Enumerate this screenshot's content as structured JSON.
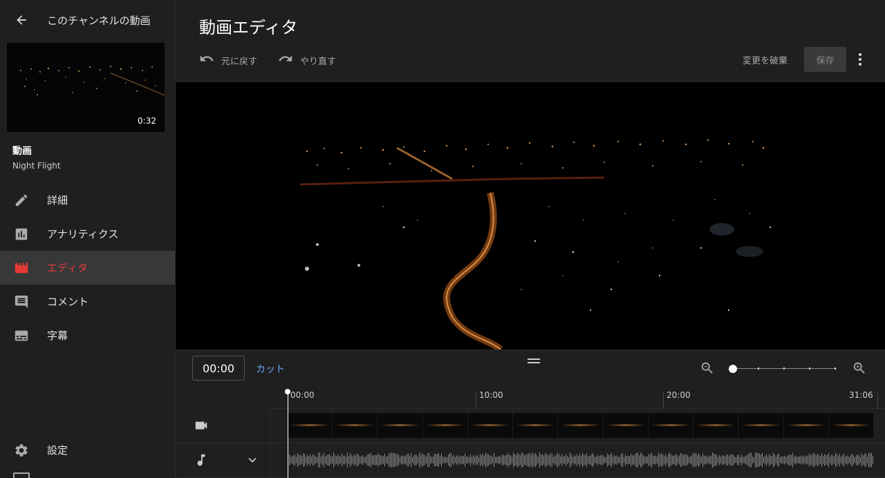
{
  "sidebar": {
    "back_title": "このチャンネルの動画",
    "thumbnail_duration": "0:32",
    "video_label": "動画",
    "video_name": "Night Flight",
    "items": [
      {
        "label": "詳細",
        "icon": "pencil-icon",
        "active": false
      },
      {
        "label": "アナリティクス",
        "icon": "analytics-icon",
        "active": false
      },
      {
        "label": "エディタ",
        "icon": "clapperboard-icon",
        "active": true
      },
      {
        "label": "コメント",
        "icon": "comment-icon",
        "active": false
      },
      {
        "label": "字幕",
        "icon": "subtitles-icon",
        "active": false
      }
    ],
    "settings_label": "設定"
  },
  "header": {
    "title": "動画エディタ",
    "undo_label": "元に戻す",
    "redo_label": "やり直す",
    "discard_label": "変更を破棄",
    "save_label": "保存"
  },
  "controls": {
    "current_time": "00:00",
    "cut_label": "カット",
    "zoom_level": 0
  },
  "timeline": {
    "ruler_labels": [
      "00:00",
      "10:00",
      "20:00",
      "31:06"
    ],
    "playhead_time": "00:00"
  },
  "colors": {
    "accent": "#e53935",
    "link": "#6fa8f5",
    "background": "#1f1f1f"
  }
}
